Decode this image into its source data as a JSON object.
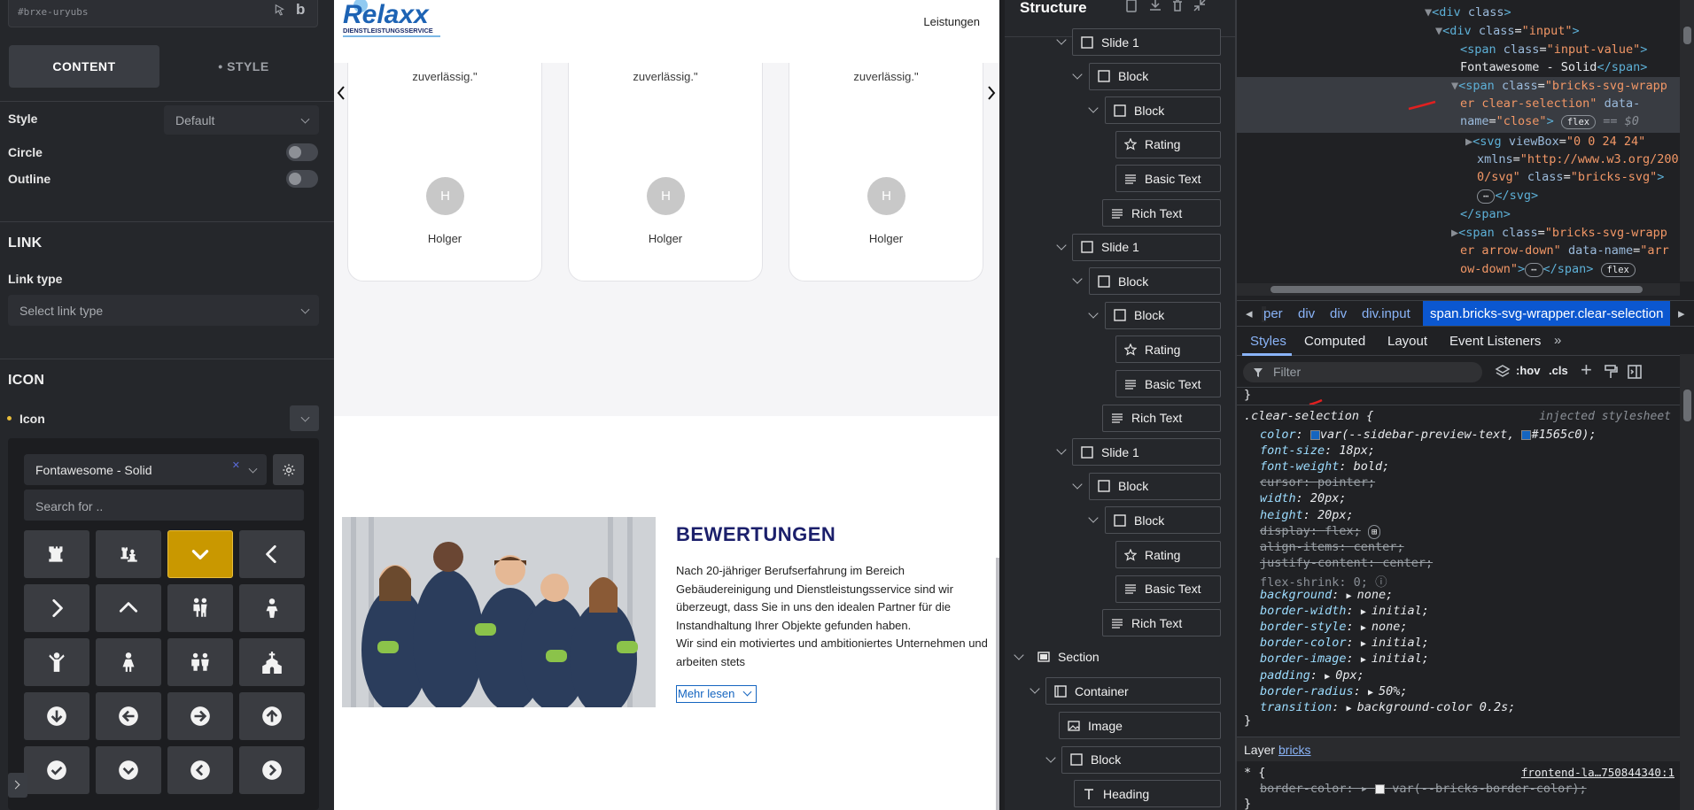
{
  "builder": {
    "element_id": "#brxe-uryubs",
    "tabs": {
      "content": "CONTENT",
      "style": "• STYLE"
    },
    "style_label": "Style",
    "style_value": "Default",
    "circle_label": "Circle",
    "outline_label": "Outline",
    "link_header": "LINK",
    "link_type_label": "Link type",
    "link_type_placeholder": "Select link type",
    "icon_header": "ICON",
    "icon_label": "Icon",
    "icon_library": "Fontawesome - Solid",
    "icon_search_placeholder": "Search for ..",
    "icons": [
      "chess-rook-icon",
      "chess-icon",
      "chevron-down-icon",
      "chevron-left-icon",
      "chevron-right-icon",
      "chevron-up-icon",
      "children-icon",
      "child-icon",
      "child-reaching-icon",
      "child-dress-icon",
      "children-group-icon",
      "church-icon",
      "circle-arrow-down-icon",
      "circle-arrow-left-icon",
      "circle-arrow-right-icon",
      "circle-arrow-up-icon",
      "circle-check-icon",
      "circle-chevron-down-icon",
      "circle-chevron-left-icon",
      "circle-chevron-right-icon"
    ],
    "selected_icon_index": 2,
    "accent": "#c99800"
  },
  "preview": {
    "logo_text": "Relaxx",
    "logo_sub": "DIENSTLEISTUNGSSERVICE",
    "nav_link": "Leistungen",
    "testimonials": [
      {
        "quote": "zuverlässig.\"",
        "initial": "H",
        "name": "Holger"
      },
      {
        "quote": "zuverlässig.\"",
        "initial": "H",
        "name": "Holger"
      },
      {
        "quote": "zuverlässig.\"",
        "initial": "H",
        "name": "Holger"
      }
    ],
    "section_title": "BEWERTUNGEN",
    "body_lines": [
      "Nach 20-jähriger Berufserfahrung im Bereich",
      "Gebäudereinigung und Dienstleistungsservice sind wir",
      "überzeugt, dass Sie in uns den idealen Partner für die",
      "Instandhaltung Ihrer Objekte gefunden haben.",
      "Wir sind ein motiviertes und ambitioniertes Unternehmen und",
      "arbeiten stets"
    ],
    "more_button": "Mehr lesen",
    "title_color": "#1b1f6b",
    "link_color": "#1565c0"
  },
  "structure": {
    "title": "Structure",
    "nodes": [
      {
        "label": "Slide 1",
        "icon": "box"
      },
      {
        "label": "Block",
        "icon": "box"
      },
      {
        "label": "Block",
        "icon": "box"
      },
      {
        "label": "Rating",
        "icon": "star"
      },
      {
        "label": "Basic Text",
        "icon": "text"
      },
      {
        "label": "Rich Text",
        "icon": "text"
      },
      {
        "label": "Slide 1",
        "icon": "box"
      },
      {
        "label": "Block",
        "icon": "box"
      },
      {
        "label": "Block",
        "icon": "box"
      },
      {
        "label": "Rating",
        "icon": "star"
      },
      {
        "label": "Basic Text",
        "icon": "text"
      },
      {
        "label": "Rich Text",
        "icon": "text"
      },
      {
        "label": "Slide 1",
        "icon": "box"
      },
      {
        "label": "Block",
        "icon": "box"
      },
      {
        "label": "Block",
        "icon": "box"
      },
      {
        "label": "Rating",
        "icon": "star"
      },
      {
        "label": "Basic Text",
        "icon": "text"
      },
      {
        "label": "Rich Text",
        "icon": "text"
      },
      {
        "label": "Section",
        "icon": "section"
      },
      {
        "label": "Container",
        "icon": "container"
      },
      {
        "label": "Image",
        "icon": "image"
      },
      {
        "label": "Block",
        "icon": "box"
      },
      {
        "label": "Heading",
        "icon": "heading"
      }
    ]
  },
  "devtools": {
    "dom": {
      "l1_tag": "div",
      "l1_attr": "class",
      "l2_tag": "div",
      "l2_attr": "class",
      "l2_val": "\"input\"",
      "l3_tag": "span",
      "l3_attr": "class",
      "l3_val": "\"input-value\"",
      "l4_text": "Fontawesome - Solid",
      "l4_close": "</span>",
      "sel_tag": "span",
      "sel_attr": "class",
      "sel_val1": "\"bricks-svg-wrapp",
      "sel_val2": "er clear-selection\"",
      "sel_attr2": "data-",
      "sel_attr3": "name",
      "sel_val3": "\"close\"",
      "sel_pill": "flex",
      "sel_eq": "== $0",
      "svg_tag": "svg",
      "svg_attr1": "viewBox",
      "svg_val1": "\"0 0 24 24\"",
      "svg_attr2": "xmlns",
      "svg_val2a": "\"http://www.w3.org/200",
      "svg_val2b": "0/svg\"",
      "svg_attr3": "class",
      "svg_val3": "\"bricks-svg\"",
      "svg_close": "</svg>",
      "span_close": "</span>",
      "n2_tag": "span",
      "n2_attr": "class",
      "n2_val1": "\"bricks-svg-wrapp",
      "n2_val2": "er arrow-down\"",
      "n2_attr2": "data-name",
      "n2_val3a": "\"arr",
      "n2_val3b": "ow-down\"",
      "n2_close": "</span>",
      "n2_pill": "flex"
    },
    "breadcrumbs": [
      "per",
      "div",
      "div",
      "div.input",
      "span.bricks-svg-wrapper.clear-selection"
    ],
    "tabs": [
      "Styles",
      "Computed",
      "Layout",
      "Event Listeners"
    ],
    "filter_placeholder": "Filter",
    "toolbar": {
      "hov": ":hov",
      "cls": ".cls"
    },
    "rule": {
      "selector": ".clear-selection {",
      "source": "injected stylesheet",
      "props": [
        {
          "n": "color",
          "v": "var(--sidebar-preview-text, ",
          "v2": "#1565c0);",
          "swatch": "#1565c0",
          "strike": false
        },
        {
          "n": "font-size",
          "v": "18px;",
          "strike": false
        },
        {
          "n": "font-weight",
          "v": "bold;",
          "strike": false
        },
        {
          "n": "cursor",
          "v": "pointer;",
          "strike": true
        },
        {
          "n": "width",
          "v": "20px;",
          "strike": false
        },
        {
          "n": "height",
          "v": "20px;",
          "strike": false
        },
        {
          "n": "display",
          "v": "flex;",
          "strike": true
        },
        {
          "n": "align-items",
          "v": "center;",
          "strike": true
        },
        {
          "n": "justify-content",
          "v": "center;",
          "strike": true
        },
        {
          "n": "flex-shrink",
          "v": "0;",
          "strike": false,
          "dim": true
        },
        {
          "n": "background",
          "v": "none;",
          "strike": false,
          "arrow": true
        },
        {
          "n": "border-width",
          "v": "initial;",
          "strike": false,
          "arrow": true
        },
        {
          "n": "border-style",
          "v": "none;",
          "strike": false,
          "arrow": true
        },
        {
          "n": "border-color",
          "v": "initial;",
          "strike": false,
          "arrow": true
        },
        {
          "n": "border-image",
          "v": "initial;",
          "strike": false,
          "arrow": true
        },
        {
          "n": "padding",
          "v": "0px;",
          "strike": false,
          "arrow": true
        },
        {
          "n": "border-radius",
          "v": "50%;",
          "strike": false,
          "arrow": true
        },
        {
          "n": "transition",
          "v": "background-color 0.2s;",
          "strike": false,
          "arrow": true
        }
      ],
      "close": "}"
    },
    "layer_label": "Layer",
    "layer_link": "bricks",
    "rule2": {
      "selector": "* {",
      "source": "frontend-la…750844340:1",
      "prop": "border-color",
      "val": "var(--bricks-border-color);"
    }
  }
}
